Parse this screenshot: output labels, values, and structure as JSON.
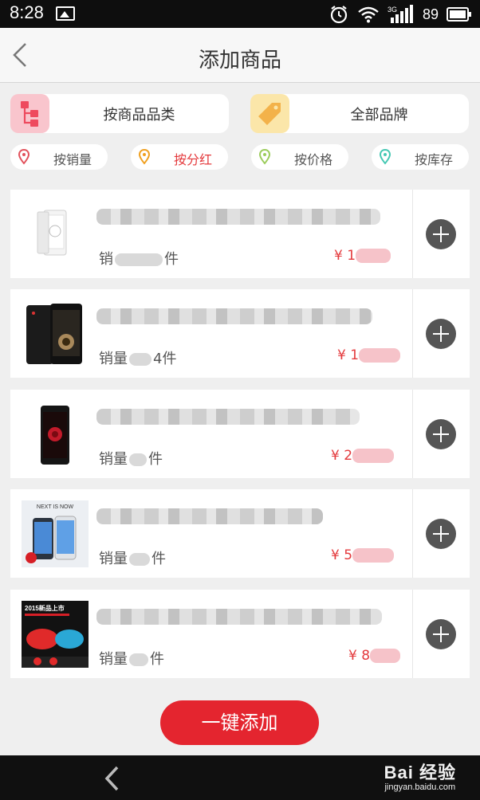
{
  "status_bar": {
    "time": "8:28",
    "network": "3G",
    "battery": "89"
  },
  "header": {
    "title": "添加商品"
  },
  "categories": [
    {
      "label": "按商品品类",
      "icon": "category-tree-icon",
      "icon_bg": "#f9c5cd",
      "icon_color": "#ee4a5e"
    },
    {
      "label": "全部品牌",
      "icon": "brand-tag-icon",
      "icon_bg": "#fbe6a9",
      "icon_color": "#f3b24a"
    }
  ],
  "filters": [
    {
      "label": "按销量",
      "pin_color": "#e2525c",
      "active": false
    },
    {
      "label": "按分红",
      "pin_color": "#f0a020",
      "active": true
    },
    {
      "label": "按价格",
      "pin_color": "#9ccc5c",
      "active": false
    },
    {
      "label": "按库存",
      "pin_color": "#45c8b3",
      "active": false
    }
  ],
  "products": [
    {
      "sales_prefix": "销",
      "sales_suffix": "件",
      "price_prefix": "¥ 1",
      "thumb": "white-phone-image"
    },
    {
      "sales_prefix": "销量",
      "sales_suffix": "4件",
      "price_prefix": "¥ 1",
      "thumb": "black-phone-image"
    },
    {
      "sales_prefix": "销量",
      "sales_suffix": "件",
      "price_prefix": "¥ 2",
      "thumb": "red-flower-phone-image"
    },
    {
      "sales_prefix": "销量",
      "sales_suffix": "件",
      "price_prefix": "¥ 5",
      "thumb": "galaxy-phones-banner-image"
    },
    {
      "sales_prefix": "销量",
      "sales_suffix": "件",
      "price_prefix": "¥ 8",
      "thumb": "red-speaker-promo-image"
    }
  ],
  "thumb_texts": {
    "galaxy": "NEXT IS NOW",
    "promo": "2015新品上市"
  },
  "action_button": "一键添加",
  "watermark": {
    "brand": "Bai 经验",
    "url": "jingyan.baidu.com"
  },
  "colors": {
    "accent": "#e4252f",
    "price": "#e4393c"
  }
}
